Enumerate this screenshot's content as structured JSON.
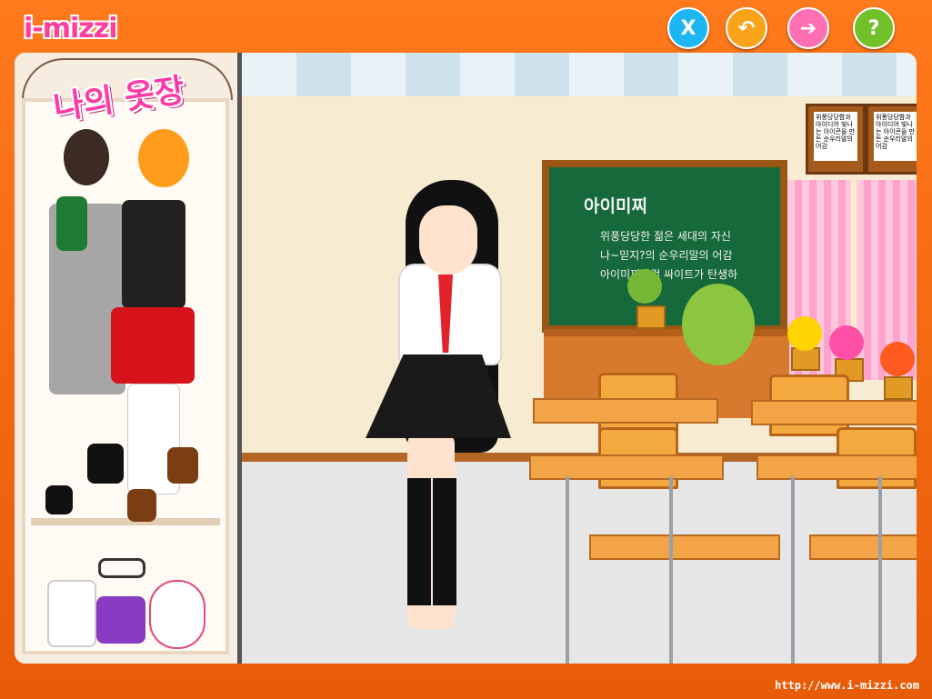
{
  "brand": {
    "logo": "i-mizzi",
    "url": "http://www.i-mizzi.com"
  },
  "controls": {
    "close": {
      "symbol": "X",
      "color": "#1db6f2"
    },
    "undo": {
      "symbol": "↶",
      "color": "#f9a31b"
    },
    "next": {
      "symbol": "➔",
      "color": "#ff6fb3"
    },
    "help": {
      "symbol": "?",
      "color": "#72c12b"
    }
  },
  "closet": {
    "title": "나의 옷장"
  },
  "board": {
    "heading": "아이미찌",
    "lines": [
      "위풍당당한 젊은 세대의 자신",
      "나~믿지?의 순우리말의 어감",
      "아이미찌닷컴 싸이트가 탄생하"
    ]
  },
  "signs": [
    {
      "text": "위풍당당함과 아이디어 빛나는 아이콘을 만든 순우리말의 어감"
    },
    {
      "text": "위풍당당함과 아이디어 빛나는 아이콘을 만든 순우리말의 어감"
    }
  ]
}
